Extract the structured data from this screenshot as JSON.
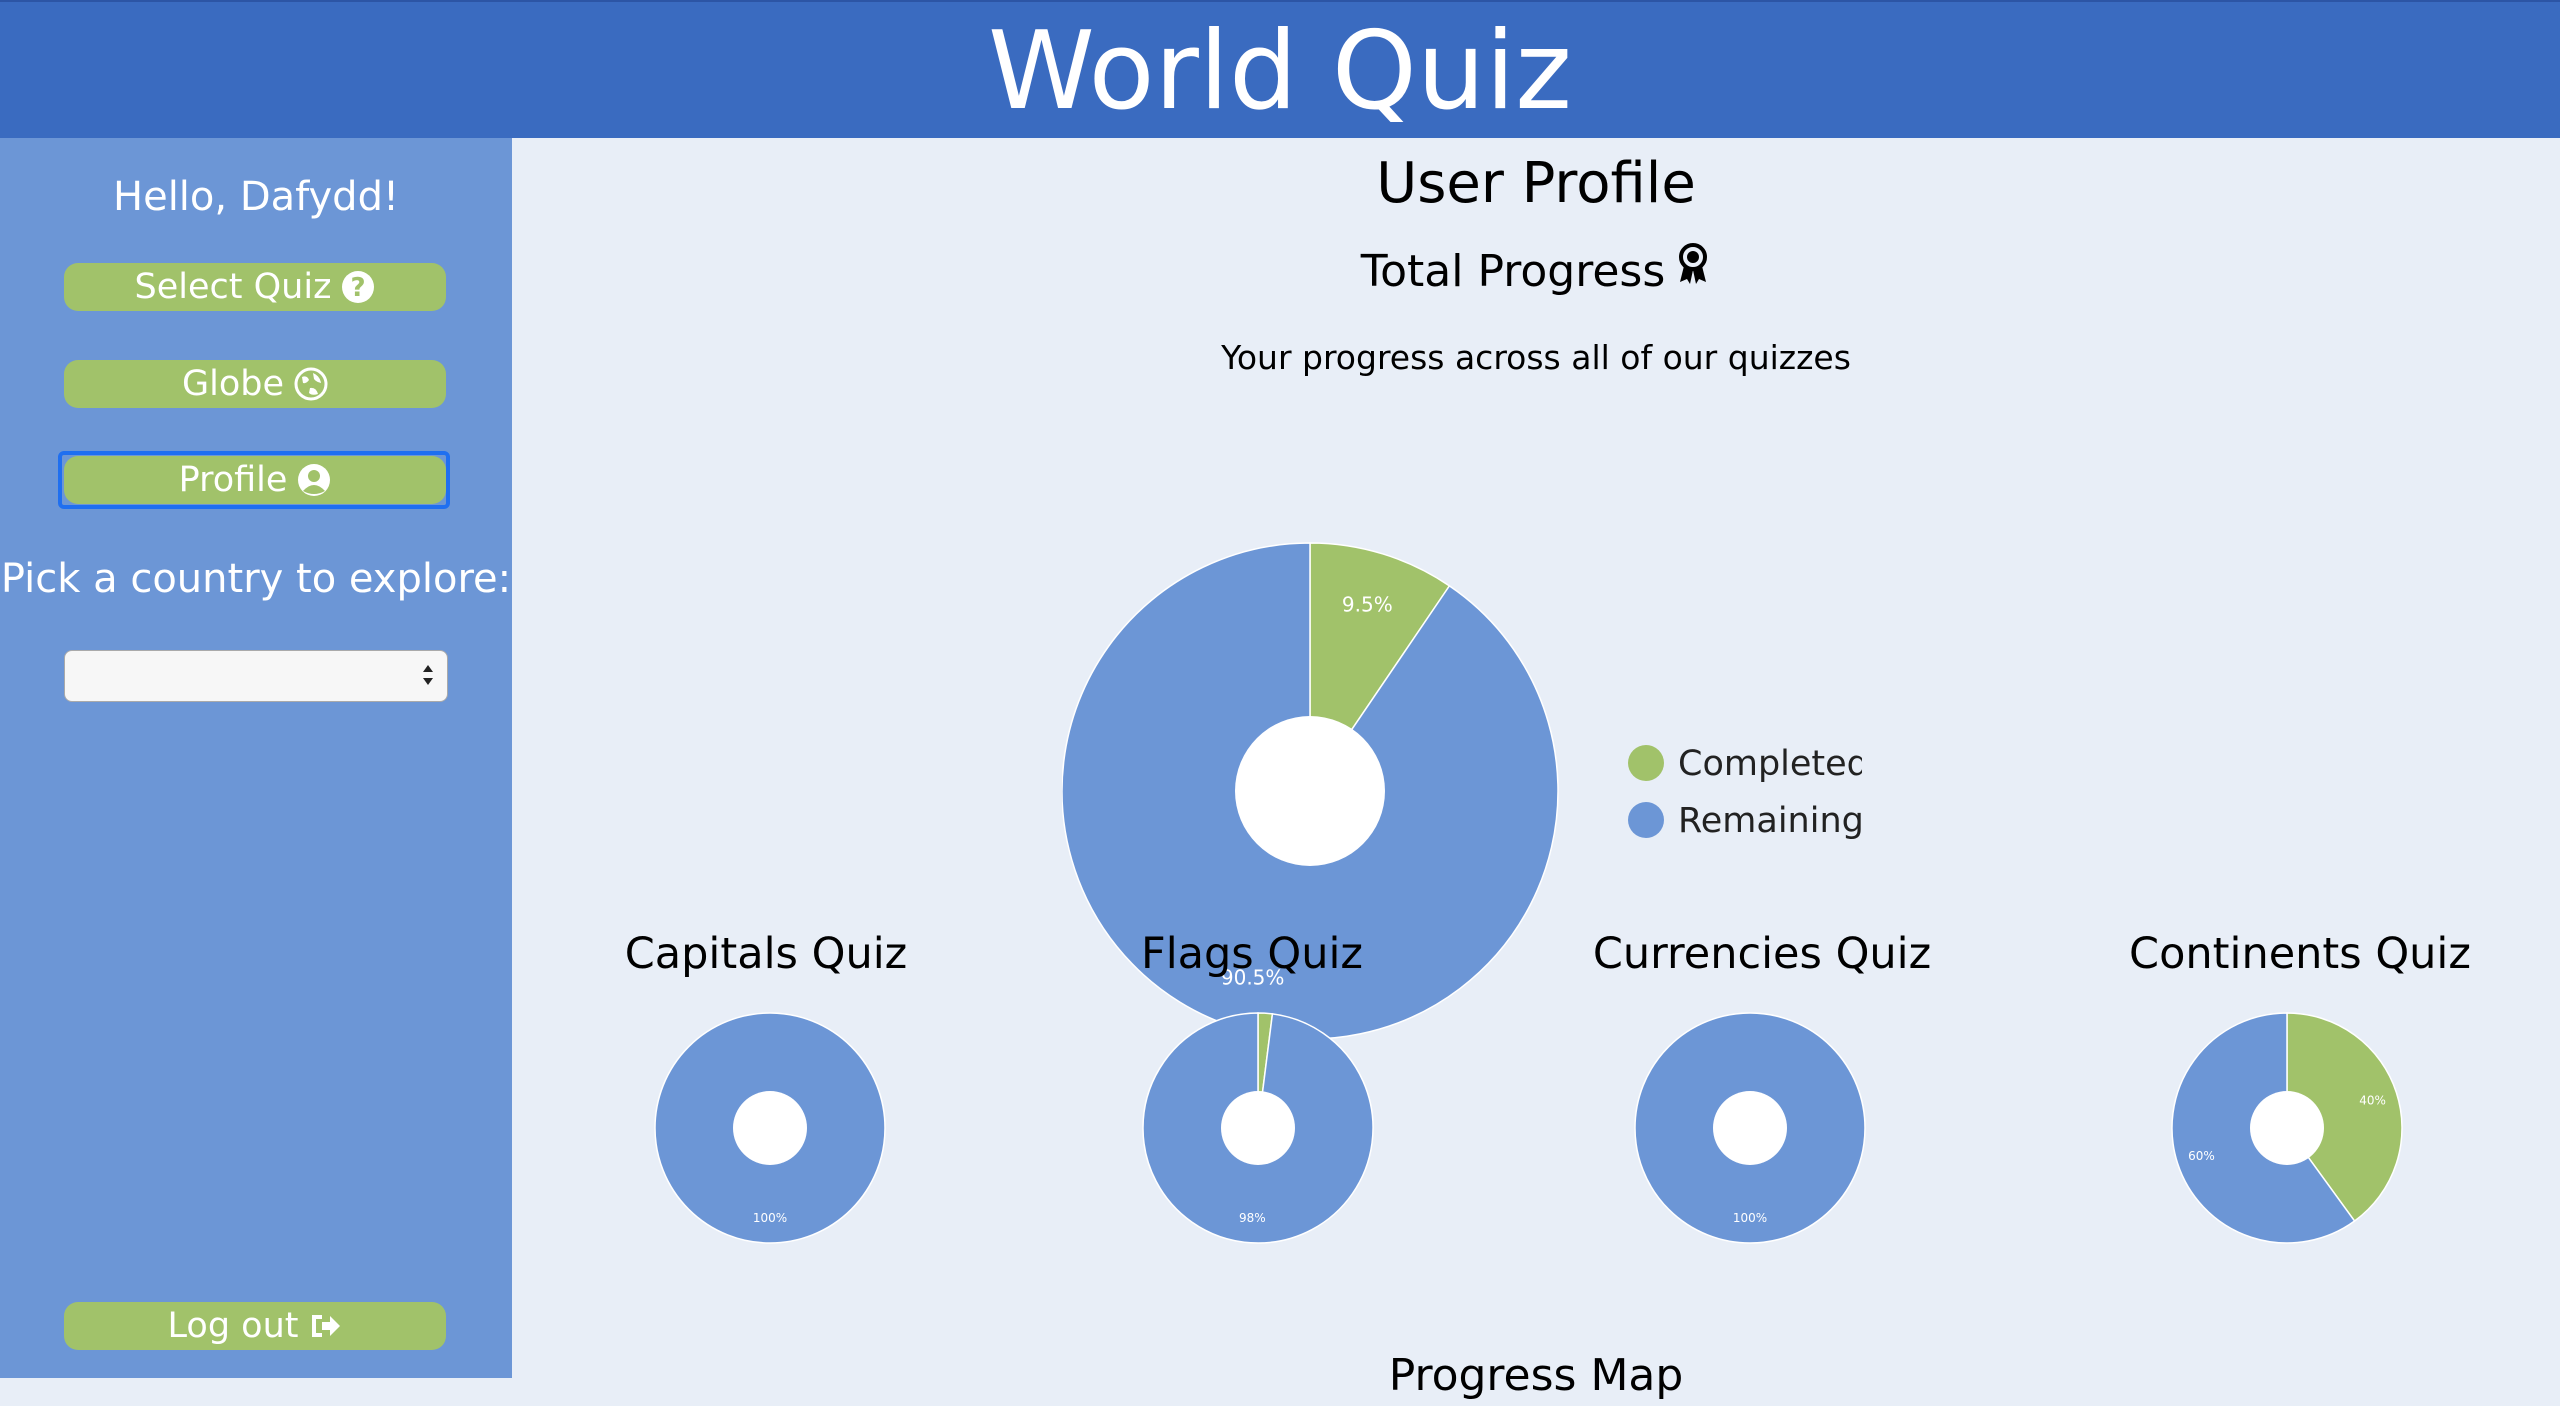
{
  "header": {
    "title": "World Quiz"
  },
  "sidebar": {
    "greeting": "Hello, Dafydd!",
    "buttons": [
      {
        "label": "Select Quiz",
        "icon": "question-circle-icon"
      },
      {
        "label": "Globe",
        "icon": "globe-icon"
      },
      {
        "label": "Profile",
        "icon": "user-circle-icon"
      }
    ],
    "pick_label": "Pick a country to explore:",
    "country_select": {
      "value": ""
    },
    "logout_label": "Log out"
  },
  "main": {
    "page_title": "User Profile",
    "section_title": "Total Progress",
    "subtitle": "Your progress across all of our quizzes",
    "progress_map_title": "Progress Map"
  },
  "colors": {
    "completed": "#a1c26a",
    "remaining": "#6c96d6",
    "header": "#3a6bc0",
    "background": "#e8eef7"
  },
  "chart_data": [
    {
      "type": "pie",
      "name": "total",
      "categories": [
        "Completed",
        "Remaining"
      ],
      "values": [
        9.5,
        90.5
      ],
      "labels": [
        "9.5%",
        "90.5%"
      ],
      "legend": [
        "Completed",
        "Remaining"
      ],
      "legend_position": "right",
      "donut": true
    },
    {
      "type": "pie",
      "name": "capitals",
      "title": "Capitals Quiz",
      "categories": [
        "Completed",
        "Remaining"
      ],
      "values": [
        0,
        100
      ],
      "labels": [
        "",
        "100%"
      ],
      "donut": true
    },
    {
      "type": "pie",
      "name": "flags",
      "title": "Flags Quiz",
      "categories": [
        "Completed",
        "Remaining"
      ],
      "values": [
        2,
        98
      ],
      "labels": [
        "",
        "98%"
      ],
      "donut": true
    },
    {
      "type": "pie",
      "name": "currencies",
      "title": "Currencies Quiz",
      "categories": [
        "Completed",
        "Remaining"
      ],
      "values": [
        0,
        100
      ],
      "labels": [
        "",
        "100%"
      ],
      "donut": true
    },
    {
      "type": "pie",
      "name": "continents",
      "title": "Continents Quiz",
      "categories": [
        "Completed",
        "Remaining"
      ],
      "values": [
        40,
        60
      ],
      "labels": [
        "40%",
        "60%"
      ],
      "donut": true
    }
  ]
}
